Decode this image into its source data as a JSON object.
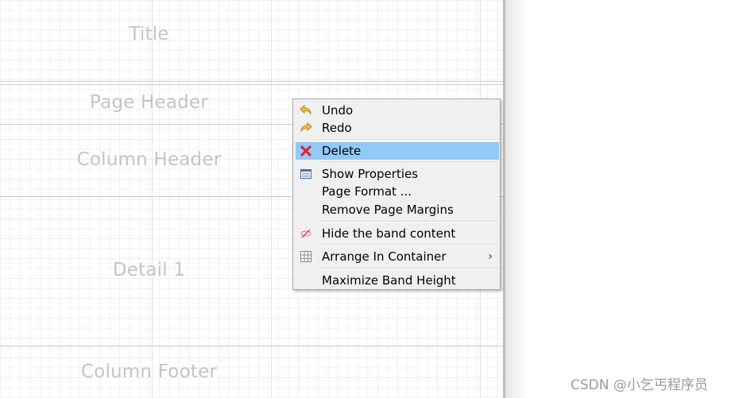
{
  "bands": {
    "title": "Title",
    "page_header": "Page Header",
    "column_header": "Column Header",
    "detail": "Detail 1",
    "column_footer": "Column Footer"
  },
  "context_menu": {
    "undo": "Undo",
    "redo": "Redo",
    "delete": "Delete",
    "show_properties": "Show Properties",
    "page_format": "Page Format ...",
    "remove_page_margins": "Remove Page Margins",
    "hide_band_content": "Hide the band content",
    "arrange_in_container": "Arrange In Container",
    "submenu_arrow": "›",
    "maximize_band_height": "Maximize Band Height",
    "highlighted_item": "Delete",
    "highlight_color": "#91c9f7"
  },
  "watermark": "CSDN @小乞丐程序员"
}
